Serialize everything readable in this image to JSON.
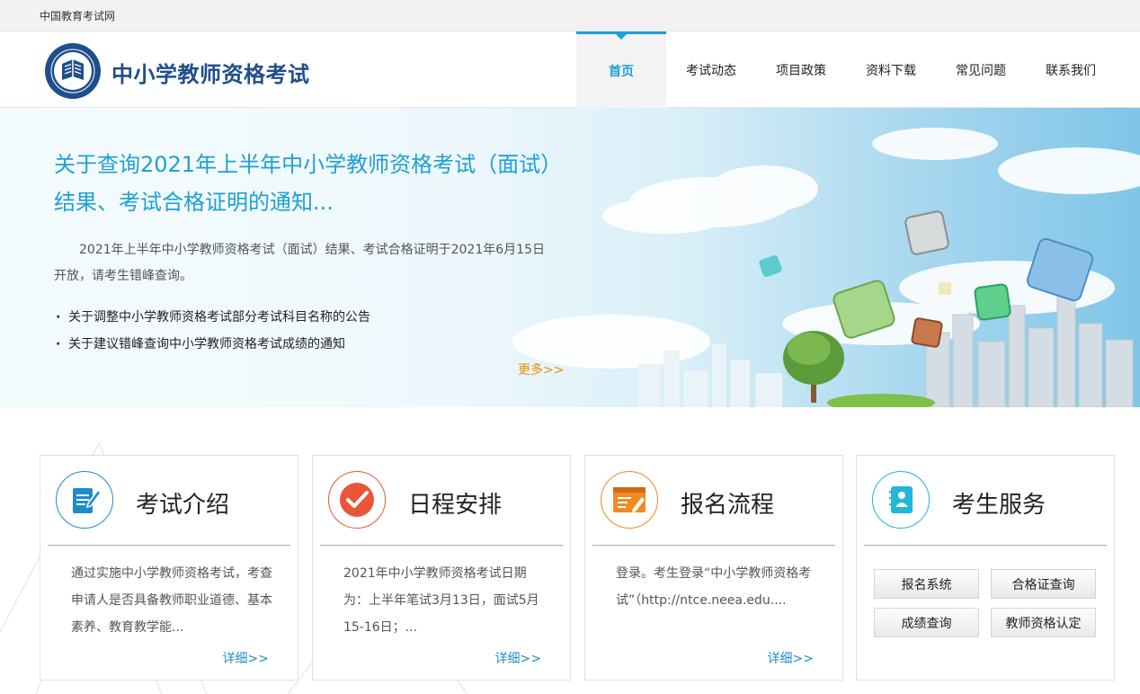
{
  "site": {
    "parent_name": "中国教育考试网",
    "title": "中小学教师资格考试"
  },
  "nav": [
    {
      "label": "首页",
      "active": true
    },
    {
      "label": "考试动态"
    },
    {
      "label": "项目政策"
    },
    {
      "label": "资料下载"
    },
    {
      "label": "常见问题"
    },
    {
      "label": "联系我们"
    }
  ],
  "banner": {
    "headline": "关于查询2021年上半年中小学教师资格考试（面试）结果、考试合格证明的通知...",
    "description": "2021年上半年中小学教师资格考试（面试）结果、考试合格证明于2021年6月15日开放，请考生错峰查询。",
    "links": [
      "关于调整中小学教师资格考试部分考试科目名称的公告",
      "关于建议错峰查询中小学教师资格考试成绩的通知"
    ],
    "more_label": "更多>>"
  },
  "cards": [
    {
      "title": "考试介绍",
      "text": "通过实施中小学教师资格考试，考查申请人是否具备教师职业道德、基本素养、教育教学能...",
      "more_label": "详细>>",
      "icon": "document-edit-icon",
      "color": "#1e8ccc"
    },
    {
      "title": "日程安排",
      "text": "2021年中小学教师资格考试日期为：上半年笔试3月13日，面试5月15-16日；...",
      "more_label": "详细>>",
      "icon": "checkmark-icon",
      "color": "#e8563a"
    },
    {
      "title": "报名流程",
      "text": "登录。考生登录“中小学教师资格考试”（http://ntce.neea.edu....",
      "more_label": "详细>>",
      "icon": "registration-form-icon",
      "color": "#f08a24"
    },
    {
      "title": "考生服务",
      "icon": "contact-book-icon",
      "color": "#22b6d8",
      "buttons": [
        "报名系统",
        "合格证查询",
        "成绩查询",
        "教师资格认定"
      ]
    }
  ]
}
